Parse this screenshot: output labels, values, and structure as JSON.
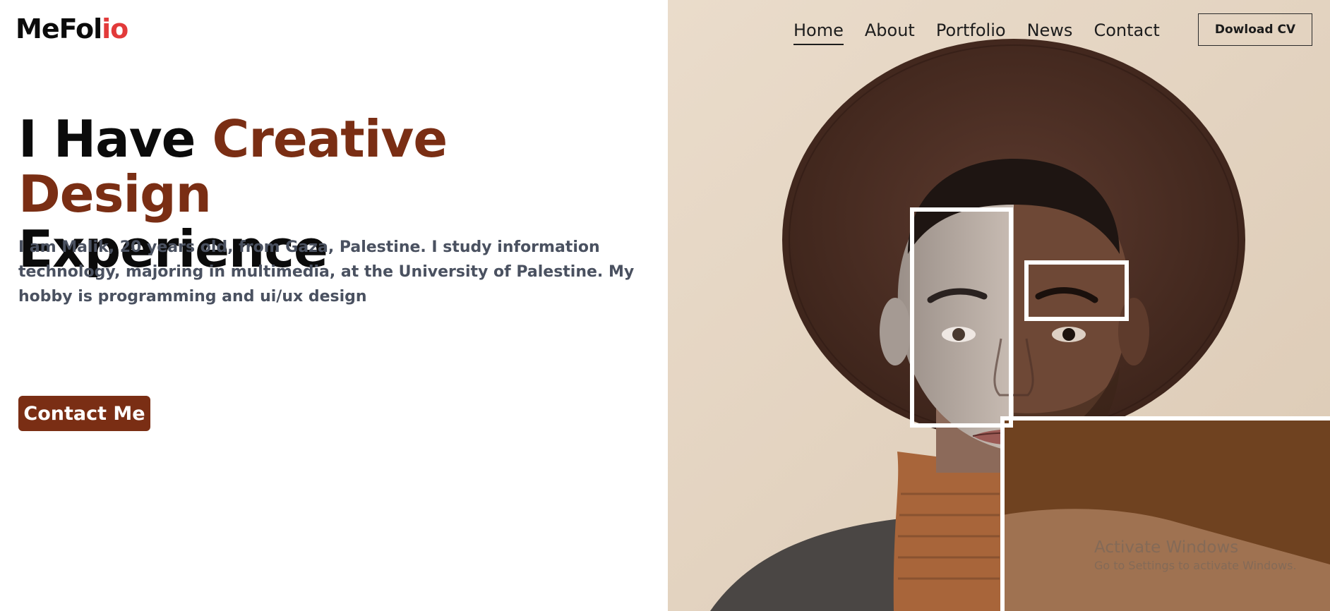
{
  "brand": {
    "logo_main": "MeFol",
    "logo_accent": "io",
    "accent_color": "#e23a3a"
  },
  "nav": {
    "items": [
      {
        "label": "Home",
        "active": true
      },
      {
        "label": "About",
        "active": false
      },
      {
        "label": "Portfolio",
        "active": false
      },
      {
        "label": "News",
        "active": false
      },
      {
        "label": "Contact",
        "active": false
      }
    ],
    "download_label": "Dowload CV"
  },
  "hero": {
    "title_part1": "I Have ",
    "title_highlight": "Creative Design",
    "title_part2": "Experience",
    "highlight_color": "#7a2e14",
    "description": "I am Malik, 20 years old, from Gaza, Palestine. I study information technology, majoring in multimedia, at the University of Palestine. My hobby is programming and ui/ux design",
    "cta_label": "Contact Me"
  },
  "photo": {
    "subject": "portrait-man-in-brown-hat",
    "background_color": "#e6d8c5"
  },
  "watermark": {
    "line1": "Activate Windows",
    "line2": "Go to Settings to activate Windows."
  }
}
